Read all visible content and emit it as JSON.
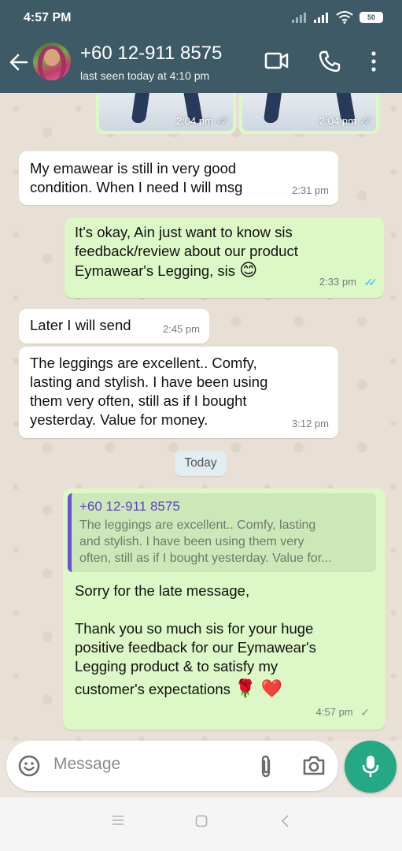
{
  "status_bar": {
    "time": "4:57 PM",
    "battery": "50"
  },
  "header": {
    "contact_name": "+60 12-911 8575",
    "last_seen": "last seen today at 4:10 pm"
  },
  "images": [
    {
      "time": "2:04 pm",
      "status": "read"
    },
    {
      "time": "2:04 pm",
      "status": "read"
    }
  ],
  "messages": [
    {
      "direction": "incoming",
      "lines": [
        "My emawear is still in very good",
        "condition. When I need I will msg"
      ],
      "time": "2:31 pm"
    },
    {
      "direction": "outgoing",
      "lines": [
        "It's okay, Ain just want to know sis",
        "feedback/review about our product",
        "Eymawear's Legging, sis"
      ],
      "emoji": "😊",
      "time": "2:33 pm",
      "status": "read"
    },
    {
      "direction": "incoming",
      "lines": [
        "Later I will send"
      ],
      "time": "2:45 pm"
    },
    {
      "direction": "incoming",
      "lines": [
        "The leggings are excellent.. Comfy,",
        "lasting and stylish. I have been using",
        "them very often, still as if I bought",
        "yesterday. Value for money."
      ],
      "time": "3:12 pm"
    }
  ],
  "date_divider": "Today",
  "reply": {
    "quoted_name": "+60 12-911 8575",
    "quoted_lines": [
      "The leggings are excellent.. Comfy, lasting",
      "and stylish. I have been using them very",
      "often, still as if I bought yesterday. Value for..."
    ],
    "lines": [
      "Sorry for the late message,",
      "",
      "Thank you so much sis for your huge",
      "positive feedback for our Eymawear's",
      "Legging product & to satisfy my",
      "customer's expectations"
    ],
    "emoji": "🌹 ❤️",
    "time": "4:57 pm",
    "status": "sent"
  },
  "composer": {
    "placeholder": "Message"
  },
  "icons": {
    "back": "arrow-left-icon",
    "video": "video-icon",
    "call": "phone-icon",
    "menu": "more-vertical-icon",
    "emoji": "emoji-icon",
    "attach": "paperclip-icon",
    "camera": "camera-icon",
    "mic": "mic-icon"
  },
  "colors": {
    "header": "#3d5a66",
    "outgoing_bubble": "#dcf8c6",
    "incoming_bubble": "#ffffff",
    "accent": "#25a884",
    "read_tick": "#34b7f1"
  }
}
